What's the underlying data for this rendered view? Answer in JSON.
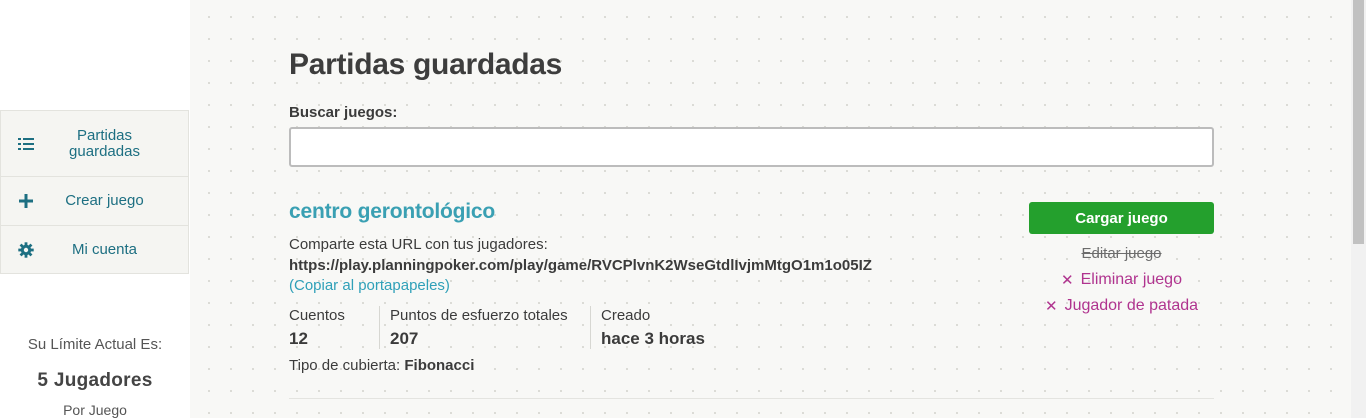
{
  "sidebar": {
    "items": [
      {
        "label_line1": "Partidas",
        "label_line2": "guardadas",
        "icon": "list-icon"
      },
      {
        "label": "Crear juego",
        "icon": "plus-icon"
      },
      {
        "label": "Mi cuenta",
        "icon": "gear-icon"
      }
    ],
    "limit": {
      "heading": "Su Límite Actual Es:",
      "value": "5 Jugadores",
      "suffix": "Por Juego"
    }
  },
  "main": {
    "title": "Partidas guardadas",
    "search": {
      "label": "Buscar juegos:",
      "value": "",
      "placeholder": ""
    },
    "games": [
      {
        "title": "centro gerontológico",
        "share_label": "Comparte esta URL con tus jugadores:",
        "url": "https://play.planningpoker.com/play/game/RVCPlvnK2WseGtdlIvjmMtgO1m1o05IZ",
        "copy_label": "(Copiar al portapapeles)",
        "stats": [
          {
            "label": "Cuentos",
            "value": "12"
          },
          {
            "label": "Puntos de esfuerzo totales",
            "value": "207"
          },
          {
            "label": "Creado",
            "value": "hace 3 horas"
          }
        ],
        "deck_label": "Tipo de cubierta:",
        "deck_value": "Fibonacci",
        "actions": {
          "load": "Cargar juego",
          "edit": "Editar juego",
          "delete": "Eliminar juego",
          "kick": "Jugador de patada"
        }
      }
    ]
  },
  "colors": {
    "accent_teal": "#3aa0b3",
    "nav_text": "#1d6f82",
    "primary_button": "#24a02d",
    "danger_link": "#b0348f"
  }
}
